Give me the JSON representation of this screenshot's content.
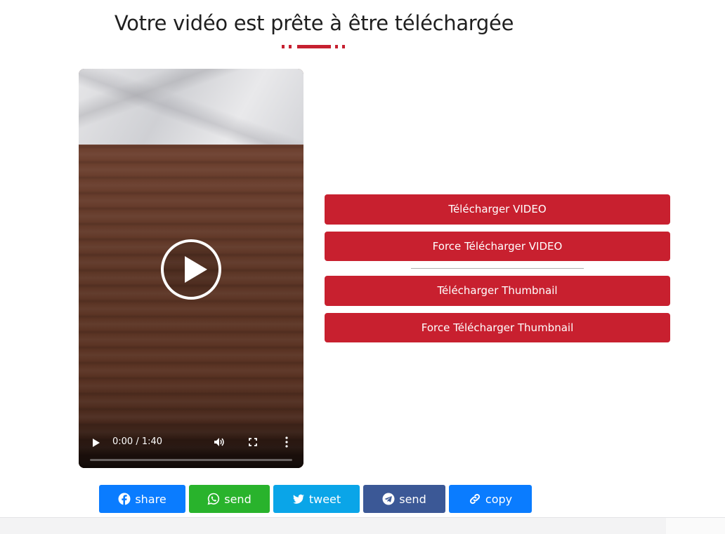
{
  "title": "Votre vidéo est prête à être téléchargée",
  "video": {
    "time": "0:00 / 1:40",
    "progress": 0
  },
  "actions": {
    "download_video": "Télécharger VIDEO",
    "force_download_video": "Force Télécharger VIDEO",
    "download_thumbnail": "Télécharger Thumbnail",
    "force_download_thumbnail": "Force Télécharger Thumbnail"
  },
  "share": [
    {
      "label": "share",
      "icon": "facebook-icon",
      "color": "#0a7cff"
    },
    {
      "label": "send",
      "icon": "whatsapp-icon",
      "color": "#29b32c"
    },
    {
      "label": "tweet",
      "icon": "twitter-icon",
      "color": "#0aa5e8"
    },
    {
      "label": "send",
      "icon": "telegram-icon",
      "color": "#3b5896"
    },
    {
      "label": "copy",
      "icon": "link-icon",
      "color": "#0a7cff"
    }
  ],
  "colors": {
    "accent": "#c8202f"
  }
}
